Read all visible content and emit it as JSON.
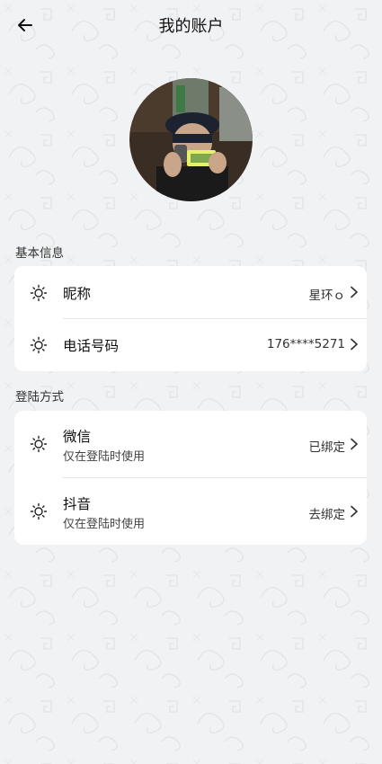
{
  "header": {
    "title": "我的账户",
    "back_icon": "back-arrow-icon"
  },
  "avatar": {
    "alt": "用户头像"
  },
  "sections": {
    "basic": {
      "label": "基本信息",
      "rows": [
        {
          "title": "昵称",
          "value": "星环ｏ",
          "icon": "sun-icon"
        },
        {
          "title": "电话号码",
          "value": "176****5271",
          "icon": "sun-icon"
        }
      ]
    },
    "login": {
      "label": "登陆方式",
      "rows": [
        {
          "title": "微信",
          "subtitle": "仅在登陆时使用",
          "value": "已绑定",
          "icon": "sun-icon"
        },
        {
          "title": "抖音",
          "subtitle": "仅在登陆时使用",
          "value": "去绑定",
          "icon": "sun-icon"
        }
      ]
    }
  },
  "colors": {
    "background": "#f1f2f3",
    "card": "#ffffff",
    "text": "#1a1a1a"
  }
}
